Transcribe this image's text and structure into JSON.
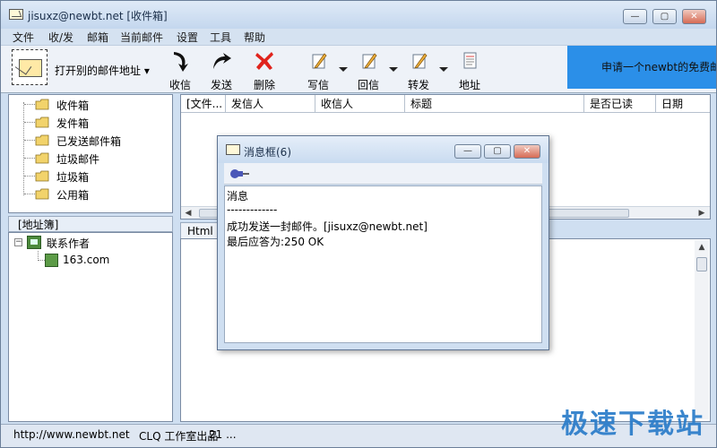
{
  "window": {
    "title": "jisuxz@newbt.net [收件箱]",
    "controls": {
      "minimize": "—",
      "maximize": "▢",
      "close": "✕"
    }
  },
  "menu": [
    "文件",
    "收/发",
    "邮箱",
    "当前邮件",
    "设置",
    "工具",
    "帮助"
  ],
  "toolbar": {
    "open_address_label": "打开别的邮件地址",
    "buttons": {
      "receive": "收信",
      "send": "发送",
      "delete": "删除",
      "compose": "写信",
      "reply": "回信",
      "forward": "转发",
      "address": "地址"
    },
    "promo_text": "申请一个newbt的免费邮"
  },
  "folders": [
    "收件箱",
    "发件箱",
    "已发送邮件箱",
    "垃圾邮件",
    "垃圾箱",
    "公用箱"
  ],
  "address_book": {
    "header": "[地址簿]",
    "expander": "−",
    "group": "联系作者",
    "contact": "163.com"
  },
  "message_list": {
    "columns": [
      "[文件...",
      "发信人",
      "收信人",
      "标题",
      "是否已读",
      "日期"
    ]
  },
  "preview": {
    "tab": "Html"
  },
  "statusbar": {
    "url": "http://www.newbt.net",
    "studio": "CLQ 工作室出品",
    "num": "21  ..."
  },
  "watermark": "极速下载站",
  "dialog": {
    "title": "消息框(6)",
    "lines": [
      "消息",
      "-------------",
      "成功发送一封邮件。[jisuxz@newbt.net]",
      "最后应答为:250 OK"
    ],
    "controls": {
      "minimize": "—",
      "maximize": "▢",
      "close": "✕"
    }
  },
  "colors": {
    "window_bg": "#cfdff1",
    "promo": "#2b8fe8",
    "delete_icon": "#e0231c",
    "watermark": "#2a7cc9",
    "folder_icon": "#f2d36b"
  }
}
